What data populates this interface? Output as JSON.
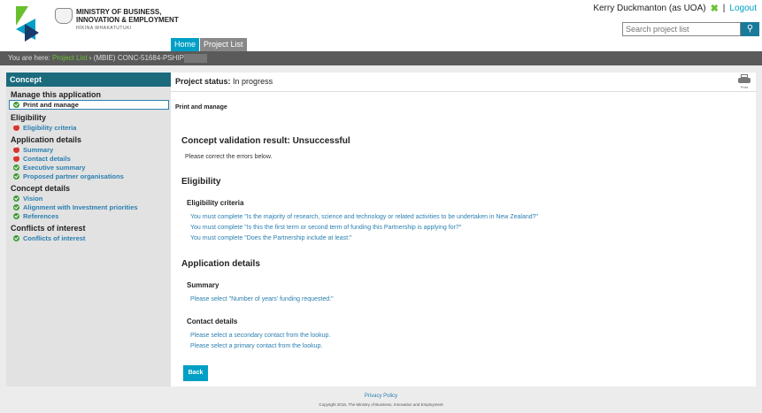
{
  "header": {
    "org_line1": "MINISTRY OF BUSINESS,",
    "org_line2": "INNOVATION & EMPLOYMENT",
    "org_sub": "HĪKINA WHAKATUTUKI",
    "user": "Kerry Duckmanton (as UOA)",
    "separator": "|",
    "logout": "Logout",
    "search_placeholder": "Search project list",
    "nav": [
      {
        "label": "Home"
      },
      {
        "label": "Project List"
      }
    ]
  },
  "breadcrumb": {
    "prefix": "You are here:",
    "link": "Project List",
    "arrow": "›",
    "current": "(MBIE) CONC-51684-PSHIP"
  },
  "sidebar": {
    "title": "Concept",
    "groups": [
      {
        "title": "Manage this application",
        "items": [
          {
            "label": "Print and manage",
            "status": "ok",
            "selected": true
          }
        ]
      },
      {
        "title": "Eligibility",
        "items": [
          {
            "label": "Eligibility criteria",
            "status": "err"
          }
        ]
      },
      {
        "title": "Application details",
        "items": [
          {
            "label": "Summary",
            "status": "err"
          },
          {
            "label": "Contact details",
            "status": "err"
          },
          {
            "label": "Executive summary",
            "status": "ok"
          },
          {
            "label": "Proposed partner organisations",
            "status": "ok"
          }
        ]
      },
      {
        "title": "Concept details",
        "items": [
          {
            "label": "Vision",
            "status": "ok"
          },
          {
            "label": "Alignment with Investment priorities",
            "status": "ok"
          },
          {
            "label": "References",
            "status": "ok"
          }
        ]
      },
      {
        "title": "Conflicts of interest",
        "items": [
          {
            "label": "Conflicts of interest",
            "status": "ok"
          }
        ]
      }
    ]
  },
  "main": {
    "status_label": "Project status:",
    "status_value": "In progress",
    "print_label": "Print",
    "section": "Print and manage",
    "result_title": "Concept validation result: Unsuccessful",
    "result_note": "Please correct the errors below.",
    "eligibility": {
      "title": "Eligibility",
      "sub": "Eligibility criteria",
      "errors": [
        "You must complete \"Is the majority of research, science and technology or related activities to be undertaken in New Zealand?\"",
        "You must complete \"Is this the first term or second term of funding this Partnership is applying for?\"",
        "You must complete \"Does the Partnership include at least:\""
      ]
    },
    "app_details": {
      "title": "Application details",
      "summary_title": "Summary",
      "summary_errors": [
        "Please select \"Number of years' funding requested:\""
      ],
      "contact_title": "Contact details",
      "contact_errors": [
        "Please select a secondary contact from the lookup.",
        "Please select a primary contact from the lookup."
      ]
    },
    "back_label": "Back"
  },
  "footer": {
    "privacy": "Privacy Policy",
    "copyright": "Copyright 2016, The Ministry of Business, Innovation and Employment"
  },
  "colors": {
    "accent_blue": "#00a0c6",
    "accent_green": "#6abf2f",
    "sidebar_head": "#1b6b7d",
    "error_red": "#d9332b",
    "ok_green": "#3d9b35"
  }
}
